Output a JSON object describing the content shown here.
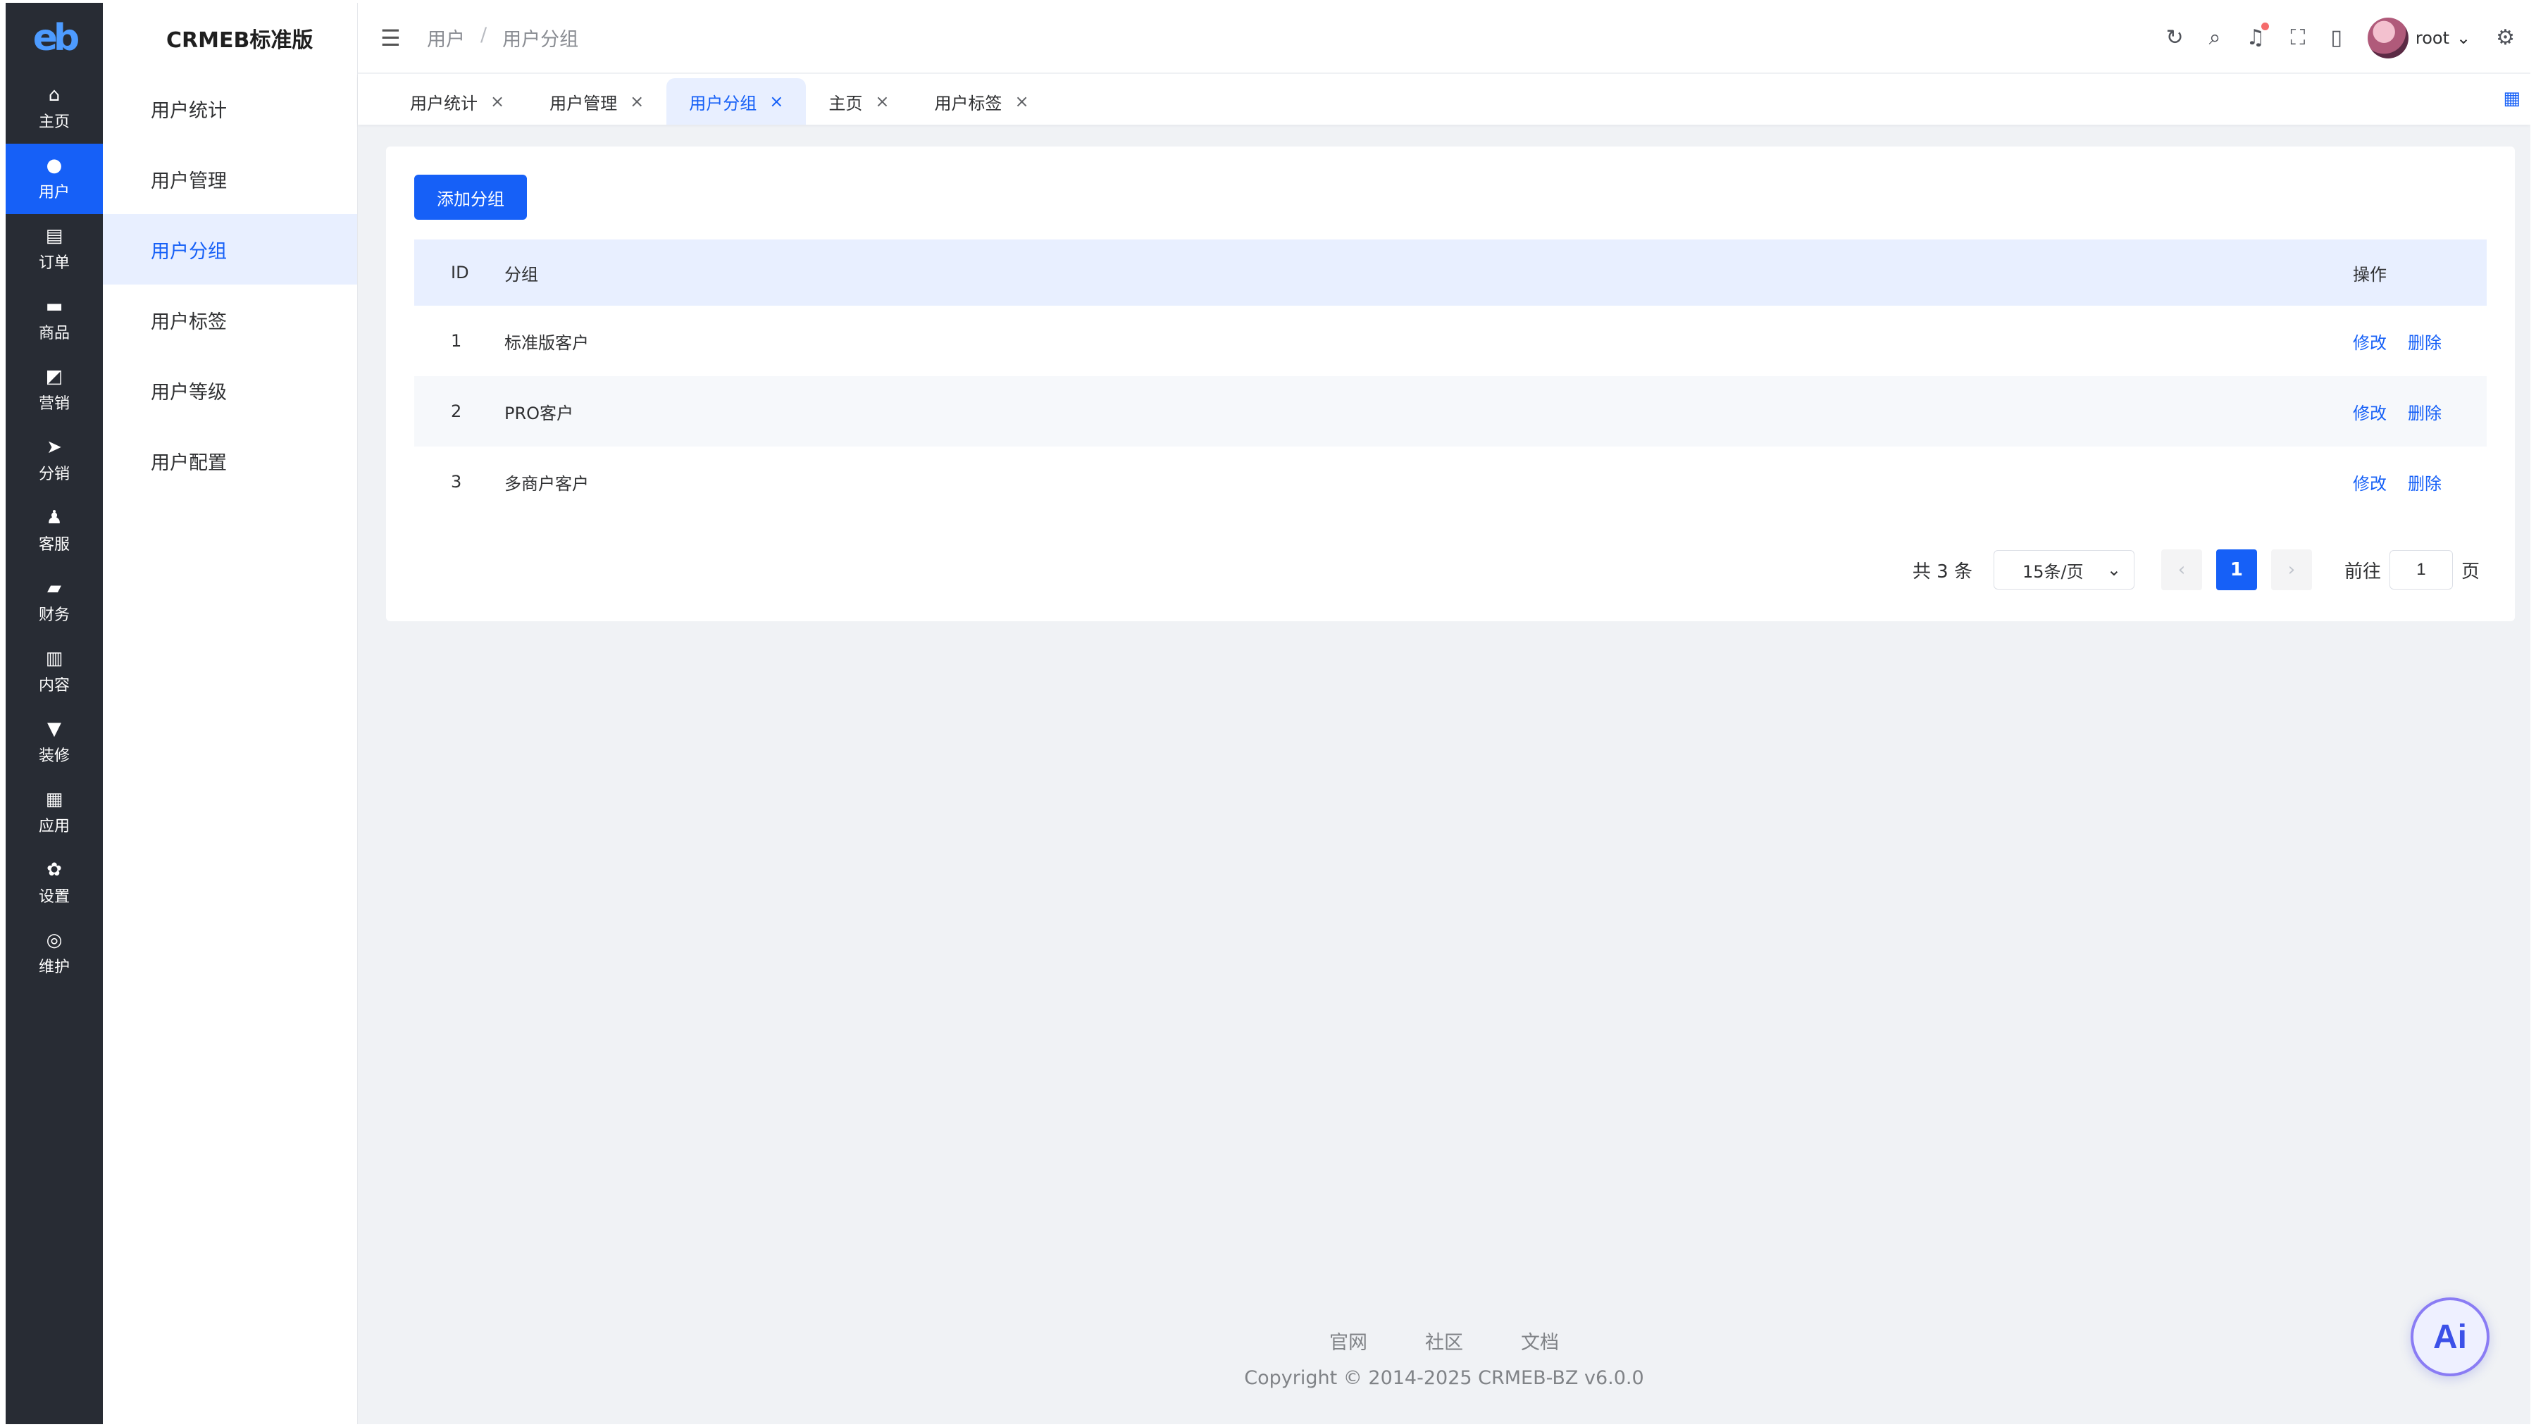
{
  "logo": "eb",
  "rail": [
    {
      "icon": "home-icon",
      "glyph": "⌂",
      "label": "主页"
    },
    {
      "icon": "user-icon",
      "glyph": "●",
      "label": "用户"
    },
    {
      "icon": "order-icon",
      "glyph": "▤",
      "label": "订单"
    },
    {
      "icon": "product-icon",
      "glyph": "▬",
      "label": "商品"
    },
    {
      "icon": "marketing-icon",
      "glyph": "◩",
      "label": "营销"
    },
    {
      "icon": "distribution-icon",
      "glyph": "➤",
      "label": "分销"
    },
    {
      "icon": "service-icon",
      "glyph": "♟",
      "label": "客服"
    },
    {
      "icon": "finance-icon",
      "glyph": "▰",
      "label": "财务"
    },
    {
      "icon": "content-icon",
      "glyph": "▥",
      "label": "内容"
    },
    {
      "icon": "decorate-icon",
      "glyph": "▼",
      "label": "装修"
    },
    {
      "icon": "apps-icon",
      "glyph": "▦",
      "label": "应用"
    },
    {
      "icon": "settings-icon",
      "glyph": "✿",
      "label": "设置"
    },
    {
      "icon": "maintain-icon",
      "glyph": "◎",
      "label": "维护"
    }
  ],
  "brand": "CRMEB标准版",
  "submenu": [
    "用户统计",
    "用户管理",
    "用户分组",
    "用户标签",
    "用户等级",
    "用户配置"
  ],
  "breadcrumb": [
    "用户",
    "用户分组"
  ],
  "header": {
    "username": "root"
  },
  "tabs": [
    "用户统计",
    "用户管理",
    "用户分组",
    "主页",
    "用户标签"
  ],
  "toolbar": {
    "add_label": "添加分组"
  },
  "table": {
    "headers": {
      "id": "ID",
      "name": "分组",
      "op": "操作"
    },
    "rows": [
      {
        "id": "1",
        "name": "标准版客户"
      },
      {
        "id": "2",
        "name": "PRO客户"
      },
      {
        "id": "3",
        "name": "多商户客户"
      }
    ],
    "edit_label": "修改",
    "delete_label": "删除"
  },
  "pagination": {
    "total_text": "共 3 条",
    "page_size": "15条/页",
    "current_page": "1",
    "goto_prefix": "前往",
    "goto_value": "1",
    "goto_suffix": "页"
  },
  "footer": {
    "links": [
      "官网",
      "社区",
      "文档"
    ],
    "copyright": "Copyright © 2014-2025 CRMEB-BZ v6.0.0"
  },
  "ai_label": "Ai",
  "colors": {
    "primary": "#1660f7",
    "rail_bg": "#282c34",
    "active_bg": "#e8efff"
  }
}
